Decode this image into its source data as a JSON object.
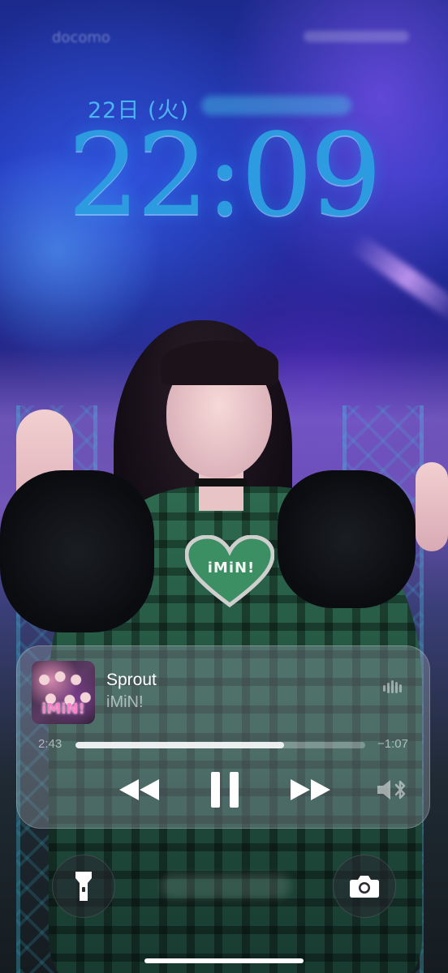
{
  "status_bar": {
    "carrier": "docomo"
  },
  "lock_screen": {
    "date": "22日 (火)",
    "time": "22:09"
  },
  "wallpaper": {
    "heart_label": "iMiN!"
  },
  "now_playing": {
    "album_label": "iMiN!",
    "title": "Sprout",
    "artist": "iMiN!",
    "elapsed": "2:43",
    "remaining": "−1:07",
    "progress_fraction": 0.72,
    "icons": {
      "airplay": "audio-waveform-icon",
      "rewind": "rewind-icon",
      "play_pause": "pause-icon",
      "forward": "fast-forward-icon",
      "output": "speaker-bluetooth-icon"
    }
  },
  "bottom_controls": {
    "left_icon": "flashlight-icon",
    "right_icon": "camera-icon"
  },
  "colors": {
    "date_and_clock": "#2c9be0",
    "player_background": "rgba(150,160,170,0.38)",
    "text_primary": "#ffffff"
  }
}
